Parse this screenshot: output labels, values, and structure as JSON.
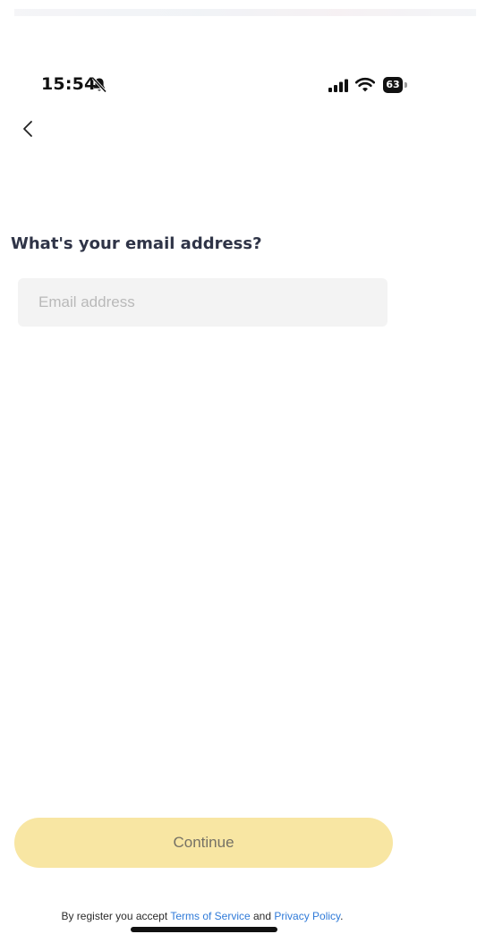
{
  "status_bar": {
    "time": "15:54",
    "battery_level": "63",
    "icons": [
      "bell-slash-icon",
      "cellular-signal-icon",
      "wifi-icon",
      "battery-icon"
    ]
  },
  "nav": {
    "back_icon": "chevron-left-icon"
  },
  "form": {
    "question": "What's your email address?",
    "email_placeholder": "Email address",
    "email_value": ""
  },
  "actions": {
    "continue_label": "Continue",
    "continue_color": "#f8e6a3"
  },
  "terms": {
    "prefix": "By register you accept ",
    "terms_link": "Terms of Service",
    "middle": " and ",
    "privacy_link": "Privacy Policy",
    "suffix": ".",
    "link_color": "#2f7ad8"
  }
}
